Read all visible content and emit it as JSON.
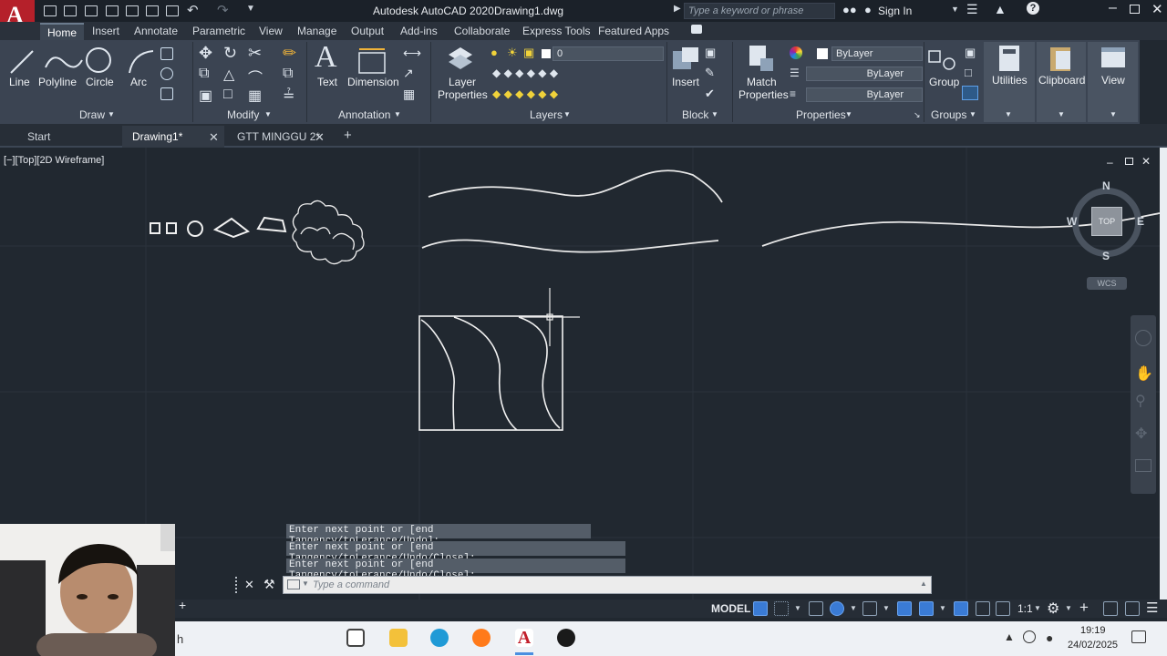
{
  "titlebar": {
    "title": "Autodesk AutoCAD 2020",
    "filename": "Drawing1.dwg",
    "search_placeholder": "Type a keyword or phrase",
    "signin": "Sign In"
  },
  "ribbon_tabs": [
    "Home",
    "Insert",
    "Annotate",
    "Parametric",
    "View",
    "Manage",
    "Output",
    "Add-ins",
    "Collaborate",
    "Express Tools",
    "Featured Apps"
  ],
  "draw_panel": {
    "title": "Draw",
    "line": "Line",
    "polyline": "Polyline",
    "circle": "Circle",
    "arc": "Arc"
  },
  "modify_panel": {
    "title": "Modify"
  },
  "annotation_panel": {
    "title": "Annotation",
    "text": "Text",
    "dimension": "Dimension"
  },
  "layers_panel": {
    "title": "Layers",
    "layer_properties_l1": "Layer",
    "layer_properties_l2": "Properties",
    "current_layer": "0"
  },
  "block_panel": {
    "title": "Block",
    "insert": "Insert"
  },
  "properties_panel": {
    "title": "Properties",
    "match_l1": "Match",
    "match_l2": "Properties",
    "color": "ByLayer",
    "linetype": "ByLayer",
    "lineweight": "ByLayer"
  },
  "groups_panel": {
    "title": "Groups",
    "group": "Group"
  },
  "utilities": "Utilities",
  "clipboard": "Clipboard",
  "view": "View",
  "file_tabs": [
    "Start",
    "Drawing1*",
    "GTT MINGGU 2*"
  ],
  "viewport_label": "[−][Top][2D Wireframe]",
  "viewcube": {
    "n": "N",
    "s": "S",
    "e": "E",
    "w": "W",
    "top": "TOP",
    "wcs": "WCS"
  },
  "command_history": [
    "Enter next point or [end Tangency/toLerance/Undo]:",
    "Enter next point or [end Tangency/toLerance/Undo/Close]:",
    "Enter next point or [end Tangency/toLerance/Undo/Close]:"
  ],
  "command_placeholder": "Type a command",
  "status": {
    "model": "MODEL",
    "scale": "1:1"
  },
  "taskbar": {
    "time": "19:19",
    "date": "24/02/2025",
    "search_fragment": "h"
  }
}
